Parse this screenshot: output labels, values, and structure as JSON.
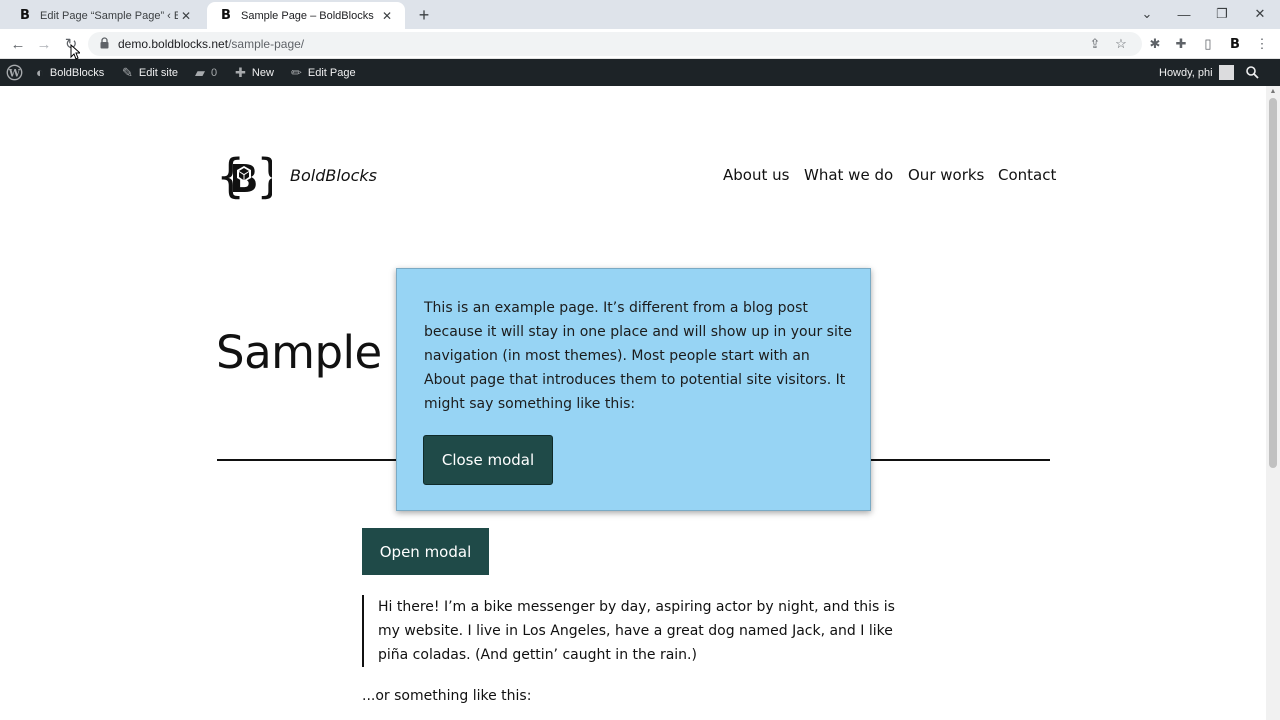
{
  "browser": {
    "tabs": [
      {
        "title": "Edit Page “Sample Page” ‹ BoldBlocks",
        "active": false
      },
      {
        "title": "Sample Page – BoldBlocks",
        "active": true
      }
    ],
    "favicon_glyph": "B",
    "url_host": "demo.boldblocks.net",
    "url_path": "/sample-page/"
  },
  "adminbar": {
    "site_name": "BoldBlocks",
    "edit_site": "Edit site",
    "comments_count": "0",
    "new_label": "New",
    "edit_page": "Edit Page",
    "howdy": "Howdy, phi"
  },
  "site": {
    "title": "BoldBlocks",
    "nav": [
      "About us",
      "What we do",
      "Our works",
      "Contact"
    ]
  },
  "page": {
    "title": "Sample P",
    "open_modal": "Open modal",
    "quote": "Hi there! I’m a bike messenger by day, aspiring actor by night, and this is my website. I live in Los Angeles, have a great dog named Jack, and I like piña coladas. (And gettin’ caught in the rain.)",
    "after_quote": "...or something like this:"
  },
  "modal": {
    "text": "This is an example page. It’s different from a blog post because it will stay in one place and will show up in your site navigation (in most themes). Most people start with an About page that introduces them to potential site visitors. It might say something like this:",
    "close_label": "Close modal"
  },
  "colors": {
    "modal_bg": "#97d4f4",
    "button_bg": "#1f4a48",
    "adminbar_bg": "#1d2327"
  }
}
